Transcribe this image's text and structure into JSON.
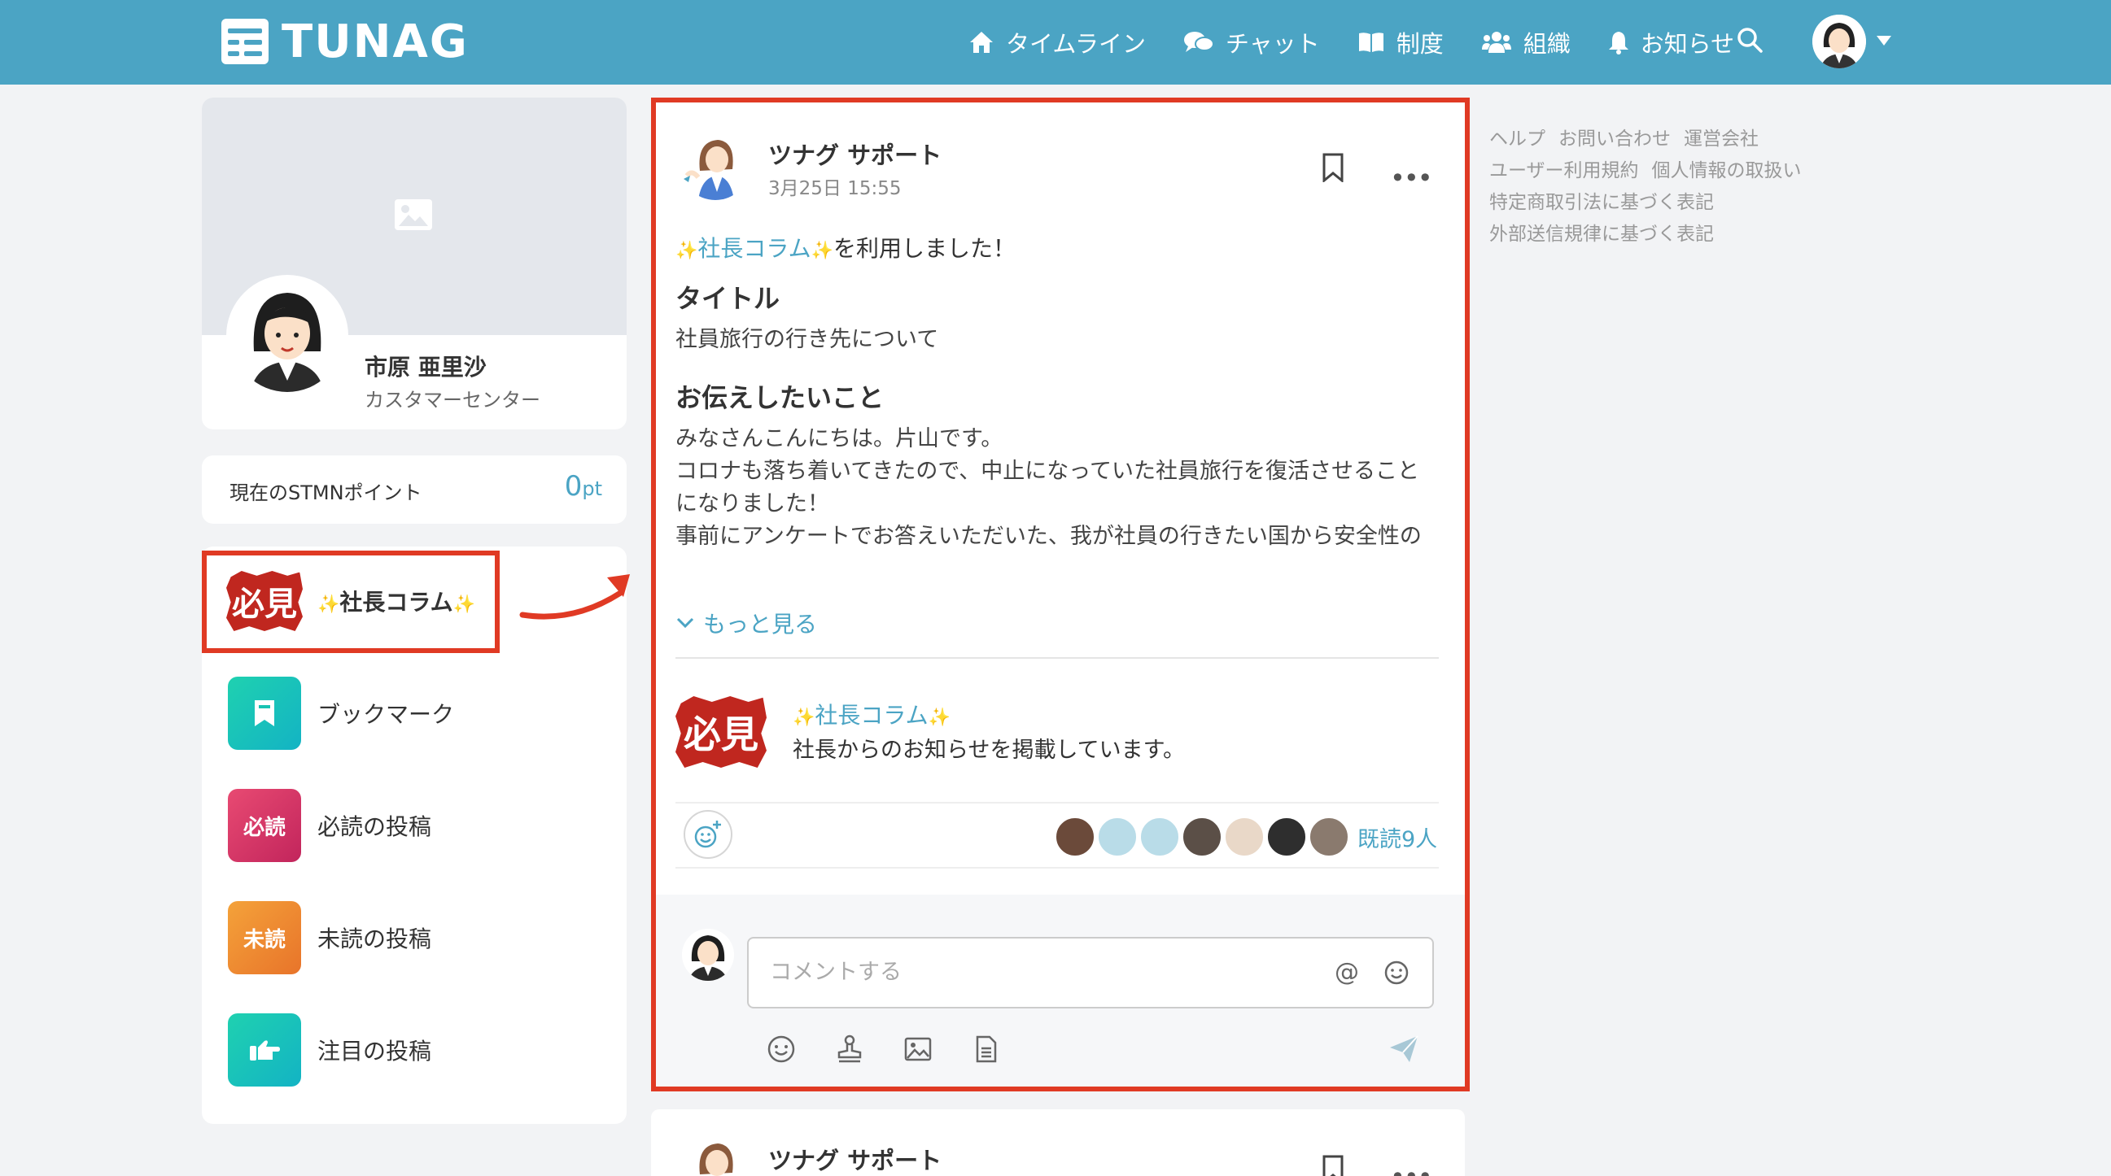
{
  "header": {
    "logo_text": "TUNAG",
    "nav": [
      {
        "label": "タイムライン",
        "icon": "home-icon"
      },
      {
        "label": "チャット",
        "icon": "chat-icon"
      },
      {
        "label": "制度",
        "icon": "book-icon"
      },
      {
        "label": "組織",
        "icon": "users-icon"
      },
      {
        "label": "お知らせ",
        "icon": "bell-icon"
      }
    ],
    "colors": {
      "bar": "#4ba4c4"
    }
  },
  "profile": {
    "name": "市原 亜里沙",
    "department": "カスタマーセンター"
  },
  "points": {
    "label": "現在のSTMNポイント",
    "value": "0",
    "unit": "pt"
  },
  "menu": {
    "column_badge": "必見",
    "column_label": "社長コラム",
    "sparkle": "✨",
    "items": [
      {
        "label": "ブックマーク",
        "icon": "bookmark-icon",
        "color": "#17c3b2"
      },
      {
        "label": "必読の投稿",
        "badge": "必読",
        "color": "#d6336c"
      },
      {
        "label": "未読の投稿",
        "badge": "未読",
        "color": "#f08c2c"
      },
      {
        "label": "注目の投稿",
        "icon": "pointing-hand-icon",
        "color": "#17c3b2"
      }
    ]
  },
  "post": {
    "author": "ツナグ サポート",
    "date": "3月25日 15:55",
    "column_name": "社長コラム",
    "used_suffix": "を利用しました！",
    "section1_title": "タイトル",
    "section1_text": "社員旅行の行き先について",
    "section2_title": "お伝えしたいこと",
    "section2_text": "みなさんこんにちは。片山です。\nコロナも落ち着いてきたので、中止になっていた社員旅行を復活させることになりました！\n事前にアンケートでお答えいただいた、我が社員の行きたい国から安全性の高い国をピックアップさせていただきました。",
    "more_label": "もっと見る",
    "column_desc": "社長からのお知らせを掲載しています。",
    "read_count": "既読9人",
    "comment_placeholder": "コメントする"
  },
  "post2": {
    "author": "ツナグ サポート"
  },
  "footer_links": [
    "ヘルプ",
    "お問い合わせ",
    "運営会社",
    "ユーザー利用規約",
    "個人情報の取扱い",
    "特定商取引法に基づく表記",
    "外部送信規律に基づく表記"
  ],
  "annotation_color": "#e03a24"
}
